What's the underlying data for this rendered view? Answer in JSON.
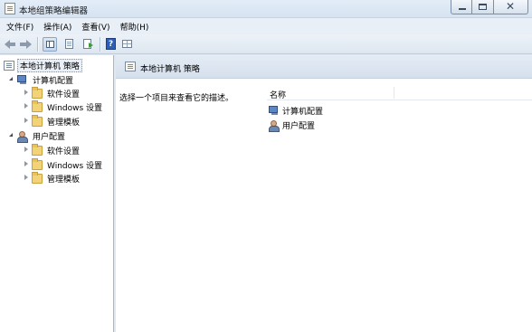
{
  "window": {
    "title": "本地组策略编辑器"
  },
  "menu": [
    "文件(F)",
    "操作(A)",
    "查看(V)",
    "帮助(H)"
  ],
  "tree": {
    "root": "本地计算机 策略",
    "computer": {
      "label": "计算机配置",
      "children": [
        "软件设置",
        "Windows 设置",
        "管理模板"
      ]
    },
    "user": {
      "label": "用户配置",
      "children": [
        "软件设置",
        "Windows 设置",
        "管理模板"
      ]
    }
  },
  "content": {
    "header_title": "本地计算机 策略",
    "description": "选择一个项目来查看它的描述。",
    "column_name": "名称",
    "items": [
      "计算机配置",
      "用户配置"
    ]
  }
}
